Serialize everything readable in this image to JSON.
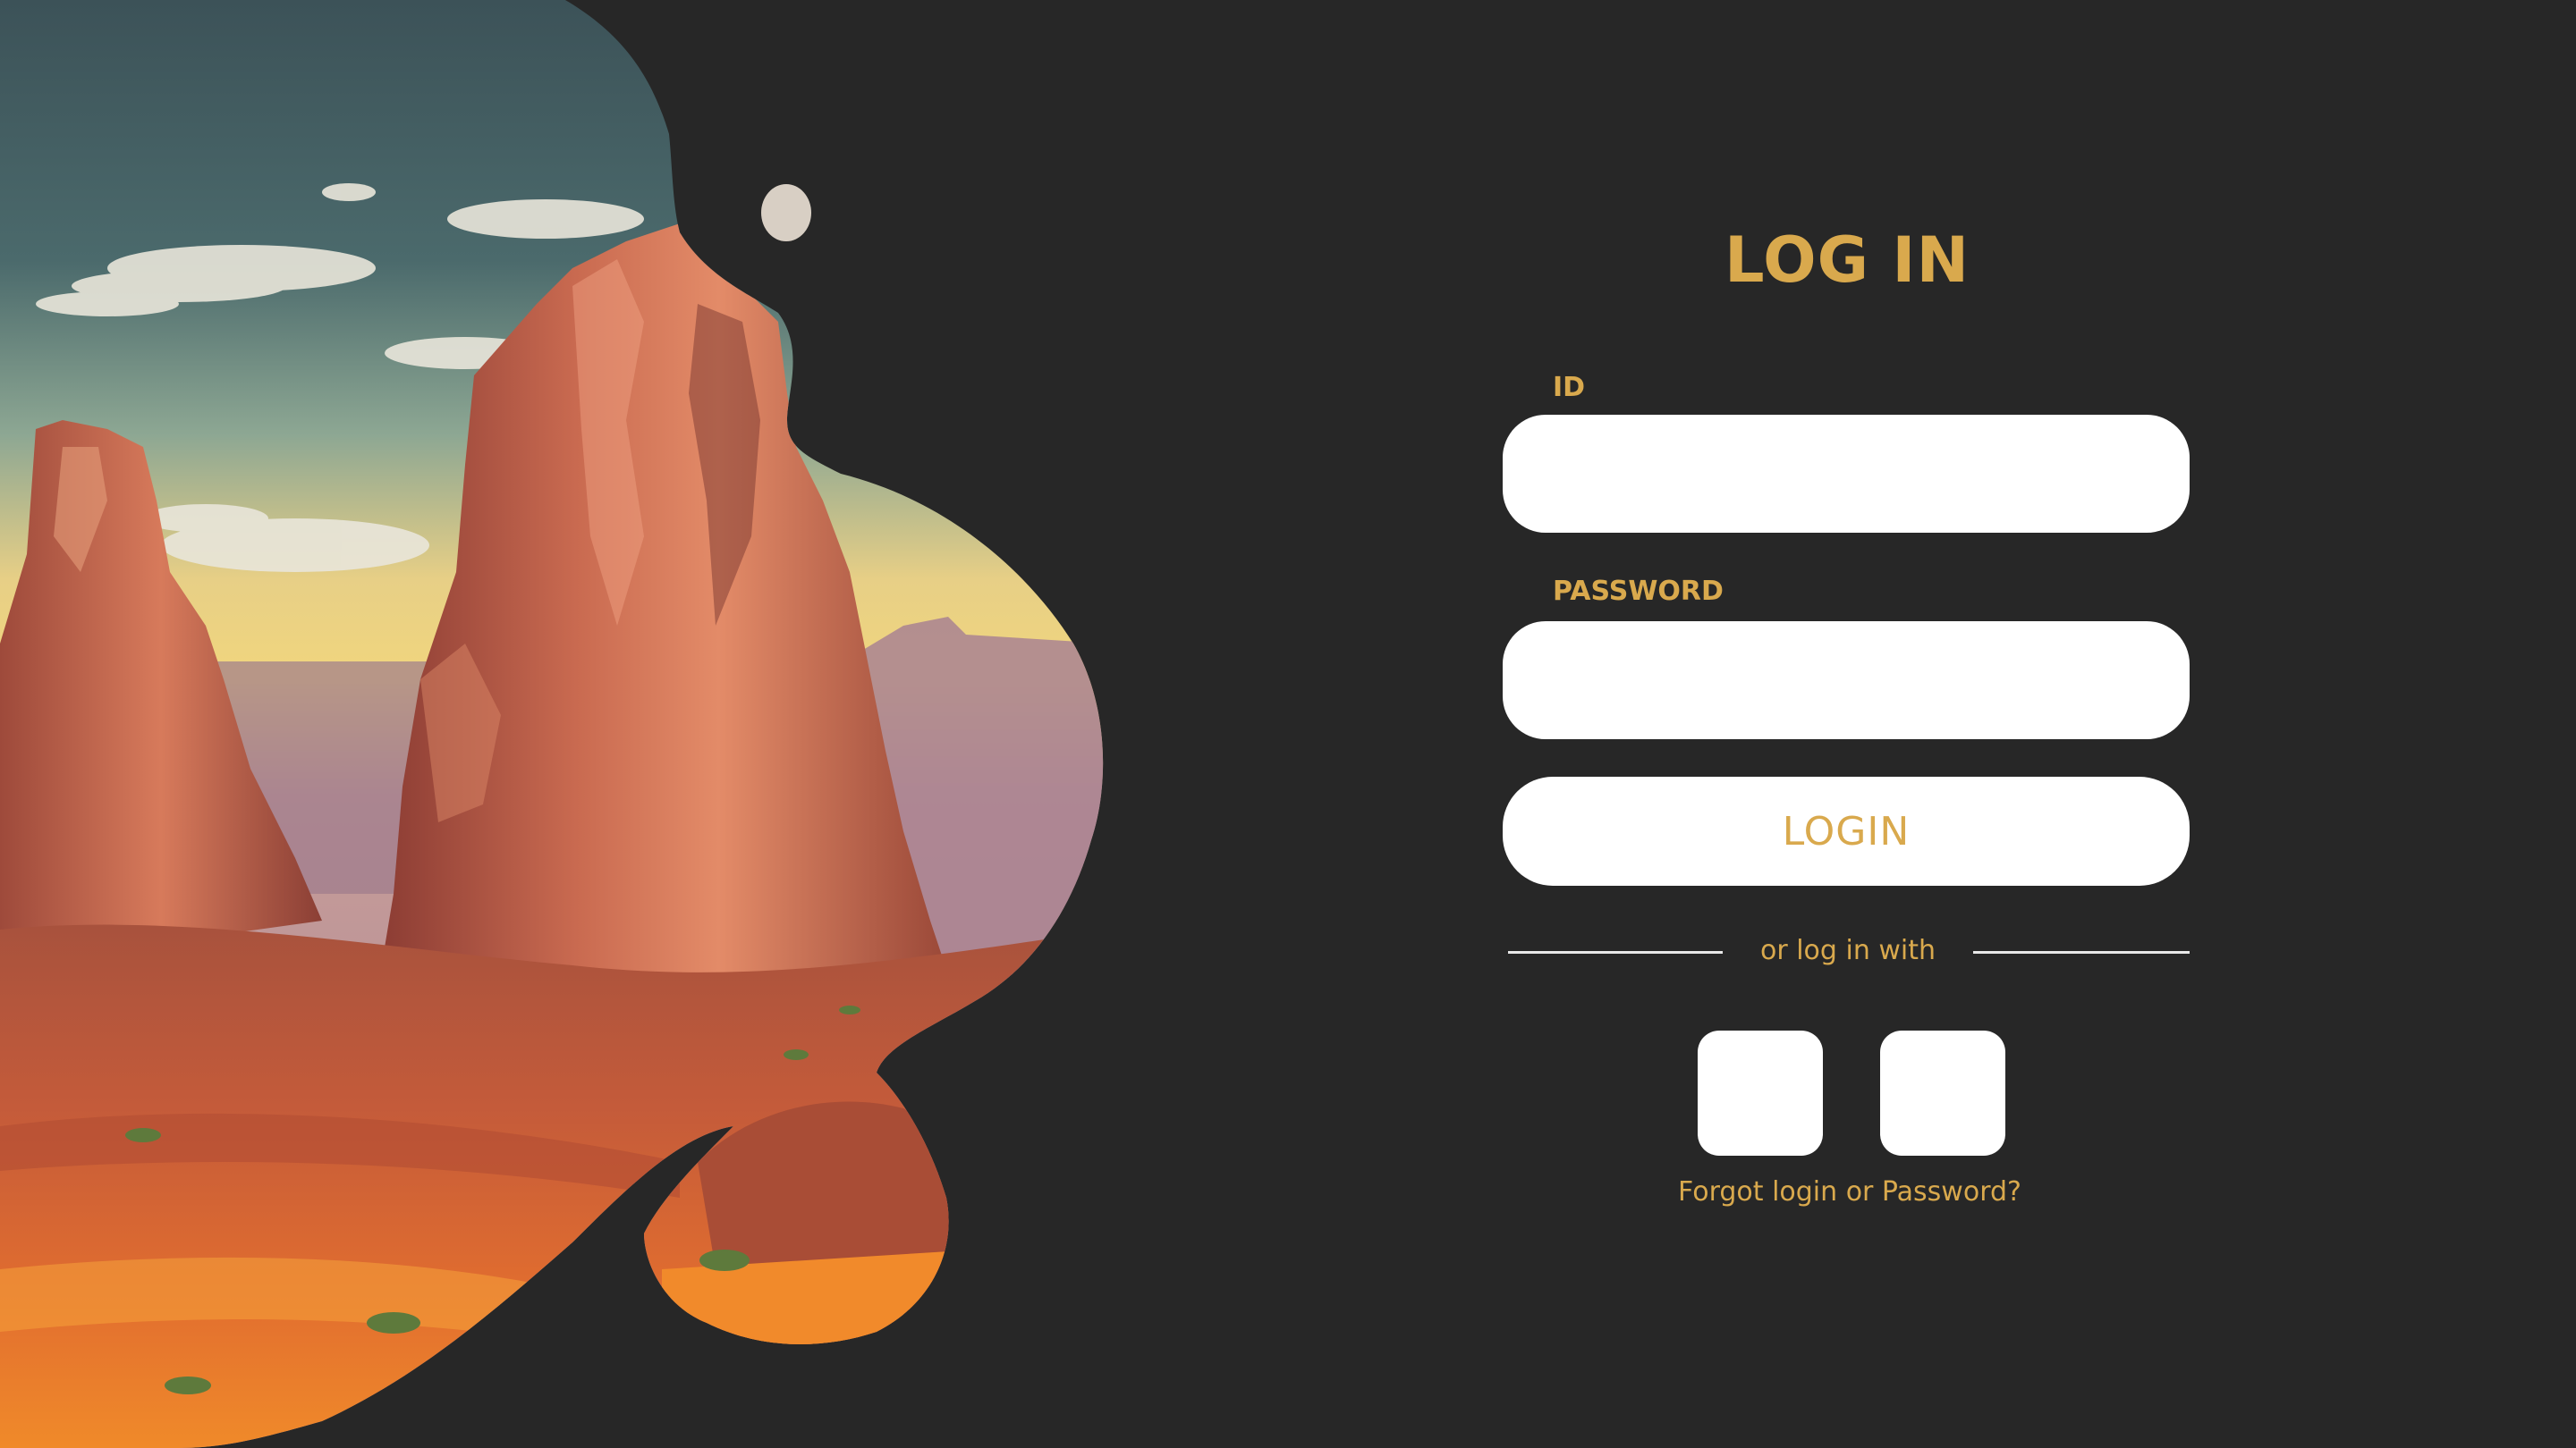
{
  "login_form": {
    "title": "LOG IN",
    "id_label": "ID",
    "id_value": "",
    "password_label": "PASSWORD",
    "password_value": "",
    "login_button": "LOGIN",
    "divider_text": "or log in with",
    "forgot_link": "Forgot login or Password?"
  },
  "social_logins": [
    {
      "icon": "blank-square-icon"
    },
    {
      "icon": "blank-square-icon"
    }
  ],
  "hero_art": {
    "subject": "painted desert mesa landscape",
    "icon": "desert-landscape-illustration"
  },
  "colors": {
    "background": "#272727",
    "accent": "#d9a94d",
    "field": "#ffffff"
  }
}
